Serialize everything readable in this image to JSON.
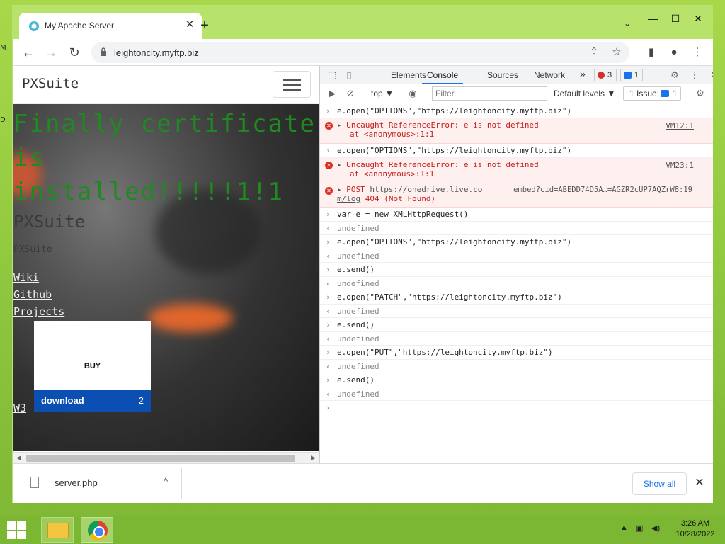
{
  "desktop": {
    "left_labels": [
      "M",
      "D"
    ]
  },
  "browser": {
    "tab_title": "My Apache Server",
    "tab_close": "✕",
    "new_tab": "+",
    "tab_search": "⌄",
    "url": "leightoncity.myftp.biz",
    "window_controls": {
      "minimize": "—",
      "maximize": "☐",
      "close": "✕"
    }
  },
  "page": {
    "brand": "PXSuite",
    "hero_title": "Finally certificate is installed!!!!!1!1",
    "sub_title": "PXSuite",
    "sub_small": "PXSuite",
    "links": [
      "Wiki",
      "Github",
      "Projects",
      "W3"
    ],
    "buy_label": "BUY",
    "download_label": "download",
    "download_count": "2"
  },
  "devtools": {
    "tabs": [
      "Elements",
      "Console",
      "Sources",
      "Network"
    ],
    "active_tab": "Console",
    "more_tabs": "»",
    "error_count": "3",
    "message_count": "1",
    "context": "top ▼",
    "filter_placeholder": "Filter",
    "levels": "Default levels ▼",
    "issues_label": "1 Issue:",
    "issues_count": "1",
    "console_rows": [
      {
        "kind": "input",
        "text": "e.open(\"OPTIONS\",\"https://leightoncity.myftp.biz\")"
      },
      {
        "kind": "error",
        "text": "Uncaught ReferenceError: e is not defined",
        "detail": "at <anonymous>:1:1",
        "source": "VM12:1"
      },
      {
        "kind": "input",
        "text": "e.open(\"OPTIONS\",\"https://leightoncity.myftp.biz\")"
      },
      {
        "kind": "error",
        "text": "Uncaught ReferenceError: e is not defined",
        "detail": "at <anonymous>:1:1",
        "source": "VM23:1"
      },
      {
        "kind": "neterror",
        "method": "POST",
        "url1": "https://onedrive.live.co",
        "url2": "m/log",
        "status": "404 (Not Found)",
        "source": "embed?cid=ABEDD74D5A…=AGZR2cUP7AQZrW8:19"
      },
      {
        "kind": "input",
        "text": "var e = new XMLHttpRequest()"
      },
      {
        "kind": "output",
        "text": "undefined"
      },
      {
        "kind": "input",
        "text": "e.open(\"OPTIONS\",\"https://leightoncity.myftp.biz\")"
      },
      {
        "kind": "output",
        "text": "undefined"
      },
      {
        "kind": "input",
        "text": "e.send()"
      },
      {
        "kind": "output",
        "text": "undefined"
      },
      {
        "kind": "input",
        "text": "e.open(\"PATCH\",\"https://leightoncity.myftp.biz\")"
      },
      {
        "kind": "output",
        "text": "undefined"
      },
      {
        "kind": "input",
        "text": "e.send()"
      },
      {
        "kind": "output",
        "text": "undefined"
      },
      {
        "kind": "input",
        "text": "e.open(\"PUT\",\"https://leightoncity.myftp.biz\")"
      },
      {
        "kind": "output",
        "text": "undefined"
      },
      {
        "kind": "input",
        "text": "e.send()"
      },
      {
        "kind": "output",
        "text": "undefined"
      },
      {
        "kind": "prompt",
        "text": ""
      }
    ]
  },
  "downloads": {
    "file_name": "server.php",
    "chevron": "^",
    "show_all": "Show all",
    "close": "✕"
  },
  "taskbar": {
    "time": "3:26 AM",
    "date": "10/28/2022"
  },
  "colors": {
    "hero_title": "#1f8a1f",
    "download_bar": "#0b4fb3",
    "error_bg": "#fff0f0",
    "error_text": "#c5221f",
    "taskbar": "#7bb732"
  }
}
